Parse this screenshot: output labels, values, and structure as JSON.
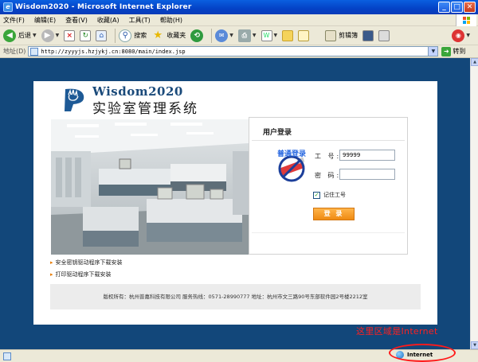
{
  "window": {
    "title": "Wisdom2020 - Microsoft Internet Explorer",
    "controls": {
      "minimize": "_",
      "maximize": "□",
      "close": "✕"
    }
  },
  "menu": [
    "文件(F)",
    "编辑(E)",
    "查看(V)",
    "收藏(A)",
    "工具(T)",
    "帮助(H)"
  ],
  "toolbar": {
    "back": "后退",
    "search": "搜索",
    "favorites": "收藏夹",
    "clipboard": "剪辑簿"
  },
  "address": {
    "label": "地址(D)",
    "url": "http://zyyyjs.hzjykj.cn:8080/main/index.jsp",
    "go": "转到"
  },
  "brand": {
    "name": "Wisdom2020",
    "subtitle": "实验室管理系统"
  },
  "login": {
    "title": "用户登录",
    "normal_login": "普通登录",
    "id_label": "工 号:",
    "id_value": "99999",
    "password_label": "密 码:",
    "remember_label": "记住工号",
    "remember_checked": true,
    "submit": "登 录"
  },
  "links": [
    "安全密钥驱动程序下载安装",
    "打印驱动程序下载安装"
  ],
  "footer": "版权所有：杭州普嘉科技有限公司 服务热线：0571-28990777 地址：杭州市文三路90号东部软件园2号楼2212室",
  "annotation": "这里区域是Internet",
  "status": {
    "zone": "Internet"
  },
  "colors": {
    "title_bar": "#0a5fe0",
    "page_bg": "#12477a",
    "login_button": "#f59a22",
    "annotation": "#ff2020"
  }
}
